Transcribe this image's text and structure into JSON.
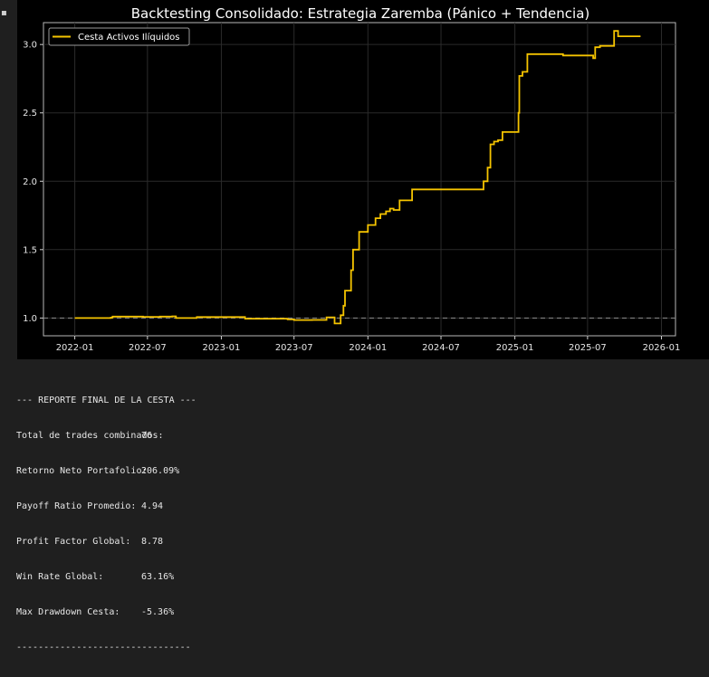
{
  "chart_data": {
    "type": "line",
    "title": "Backtesting Consolidado: Estrategia Zaremba (Pánico + Tendencia)",
    "xlabel": "",
    "ylabel": "",
    "x_ticks": [
      "2022-01",
      "2022-07",
      "2023-01",
      "2023-07",
      "2024-01",
      "2024-07",
      "2025-01",
      "2025-07",
      "2026-01"
    ],
    "y_ticks": [
      "1.0",
      "1.5",
      "2.0",
      "2.5",
      "3.0"
    ],
    "xlim": [
      "2021-10-15",
      "2026-02-05"
    ],
    "ylim": [
      0.87,
      3.16
    ],
    "grid": true,
    "legend_position": "upper-left",
    "baseline": {
      "y": 1.0,
      "style": "dashed",
      "color": "#8c8c8c"
    },
    "series": [
      {
        "name": "Cesta Activos Ilíquidos",
        "color": "#f5c400",
        "step": true,
        "points": [
          [
            "2022-01-01",
            1.0
          ],
          [
            "2022-04-01",
            1.003
          ],
          [
            "2022-04-05",
            1.01
          ],
          [
            "2022-06-20",
            1.008
          ],
          [
            "2022-08-01",
            1.01
          ],
          [
            "2022-09-01",
            1.012
          ],
          [
            "2022-09-10",
            1.0
          ],
          [
            "2022-11-01",
            1.007
          ],
          [
            "2023-03-01",
            0.995
          ],
          [
            "2023-06-15",
            0.99
          ],
          [
            "2023-07-01",
            0.985
          ],
          [
            "2023-08-15",
            0.986
          ],
          [
            "2023-09-20",
            1.005
          ],
          [
            "2023-10-10",
            0.96
          ],
          [
            "2023-10-25",
            1.02
          ],
          [
            "2023-11-01",
            1.09
          ],
          [
            "2023-11-05",
            1.2
          ],
          [
            "2023-11-20",
            1.35
          ],
          [
            "2023-11-25",
            1.5
          ],
          [
            "2023-12-10",
            1.63
          ],
          [
            "2024-01-01",
            1.68
          ],
          [
            "2024-01-20",
            1.73
          ],
          [
            "2024-02-01",
            1.76
          ],
          [
            "2024-02-15",
            1.78
          ],
          [
            "2024-02-25",
            1.8
          ],
          [
            "2024-03-05",
            1.79
          ],
          [
            "2024-03-20",
            1.86
          ],
          [
            "2024-04-20",
            1.94
          ],
          [
            "2024-10-15",
            2.0
          ],
          [
            "2024-10-25",
            2.1
          ],
          [
            "2024-11-01",
            2.27
          ],
          [
            "2024-11-10",
            2.29
          ],
          [
            "2024-11-20",
            2.3
          ],
          [
            "2024-12-01",
            2.36
          ],
          [
            "2024-12-20",
            2.36
          ],
          [
            "2025-01-10",
            2.5
          ],
          [
            "2025-01-12",
            2.77
          ],
          [
            "2025-01-20",
            2.8
          ],
          [
            "2025-02-01",
            2.93
          ],
          [
            "2025-04-15",
            2.93
          ],
          [
            "2025-05-01",
            2.92
          ],
          [
            "2025-07-15",
            2.9
          ],
          [
            "2025-07-20",
            2.98
          ],
          [
            "2025-08-01",
            2.99
          ],
          [
            "2025-09-05",
            3.1
          ],
          [
            "2025-09-15",
            3.06
          ],
          [
            "2025-11-10",
            3.06
          ]
        ]
      }
    ]
  },
  "report": {
    "header": "--- REPORTE FINAL DE LA CESTA ---",
    "stats": [
      {
        "label": "Total de trades combinados:",
        "value": "76"
      },
      {
        "label": "Retorno Neto Portafolio:",
        "value": "206.09%"
      },
      {
        "label": "Payoff Ratio Promedio:",
        "value": "4.94"
      },
      {
        "label": "Profit Factor Global:",
        "value": "8.78"
      },
      {
        "label": "Win Rate Global:",
        "value": "63.16%"
      },
      {
        "label": "Max Drawdown Cesta:",
        "value": "-5.36%"
      }
    ],
    "footer": "--------------------------------"
  }
}
